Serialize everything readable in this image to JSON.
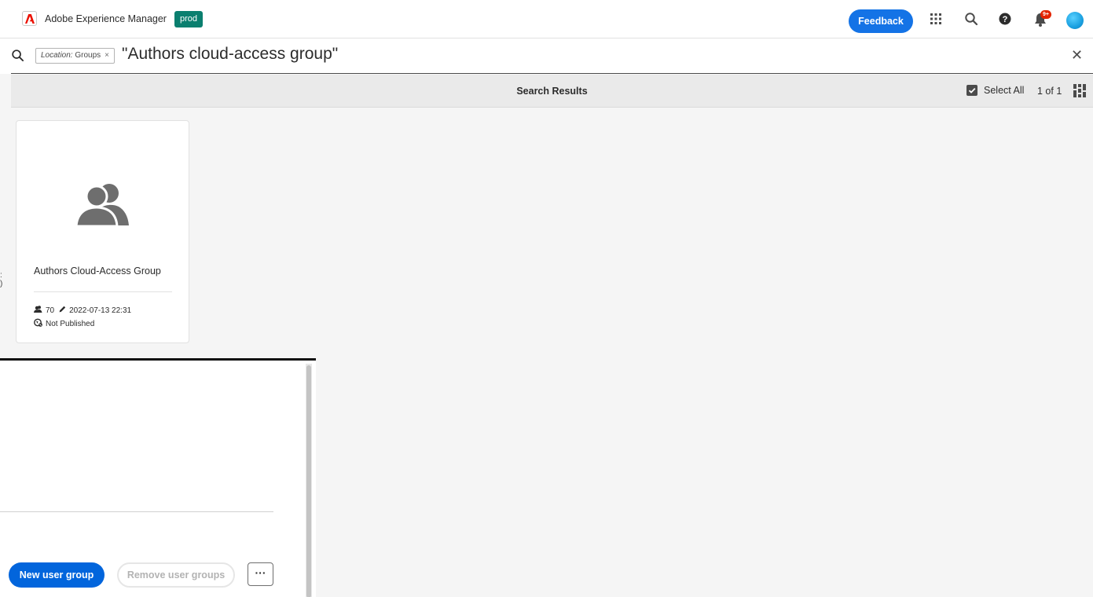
{
  "shell": {
    "app_name": "Adobe Experience Manager",
    "environment": "prod",
    "feedback_label": "Feedback",
    "notification_badge": "9+",
    "icons": [
      "adobe-logo-icon",
      "apps-grid-icon",
      "search-icon",
      "help-icon",
      "bell-icon",
      "avatar"
    ]
  },
  "search": {
    "filter_tag_prefix": "Location:",
    "filter_tag_value": " Groups",
    "filter_tag_remove": "×",
    "query": "\"Authors cloud-access group\"",
    "close_label": "✕"
  },
  "actionbar": {
    "title": "Search Results",
    "select_all_label": "Select All",
    "pagination": "1 of 1"
  },
  "results": [
    {
      "name": "Authors Cloud-Access Group",
      "member_count": "70",
      "modified": "2022-07-13 22:31",
      "publish_status": "Not Published"
    }
  ],
  "edge_glyph": ":\n)",
  "panel": {
    "new_group_label": "New user group",
    "remove_groups_label": "Remove user groups",
    "more_label": "···"
  },
  "colors": {
    "accent": "#1473e6",
    "primary_button": "#0265dc",
    "environment_badge": "#0b7f6f",
    "notification": "#e32400"
  }
}
